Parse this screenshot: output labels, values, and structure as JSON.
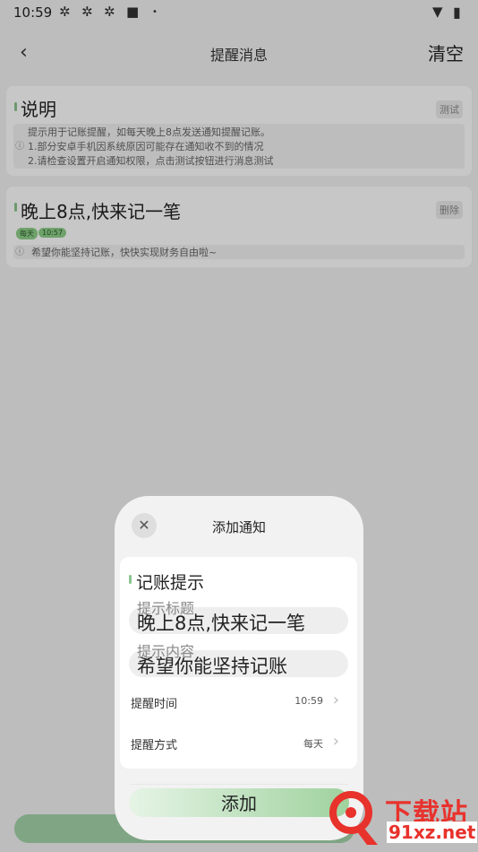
{
  "status_bar": {
    "time": "10:59",
    "icons": [
      "app-icon",
      "app-icon",
      "app-icon",
      "square-icon",
      "dot-icon",
      "wifi-icon",
      "battery-icon"
    ]
  },
  "header": {
    "back_icon": "back-arrow",
    "title": "提醒消息",
    "clear_label": "清空"
  },
  "cards": [
    {
      "title": "说明",
      "action_label": "测试",
      "note_lines": [
        "提示用于记账提醒，如每天晚上8点发送通知提醒记账。",
        "1.部分安卓手机因系统原因可能存在通知收不到的情况",
        "2.请检查设置开启通知权限，点击测试按钮进行消息测试"
      ]
    },
    {
      "title": "晚上8点,快来记一笔",
      "action_label": "删除",
      "badges": [
        "每天",
        "10:57"
      ],
      "note": "希望你能坚持记账，快快实现财务自由啦~"
    }
  ],
  "modal": {
    "title": "添加通知",
    "section_title": "记账提示",
    "title_field": {
      "placeholder": "提示标题",
      "value": "晚上8点,快来记一笔"
    },
    "content_field": {
      "placeholder": "提示内容",
      "value": "希望你能坚持记账"
    },
    "rows": [
      {
        "label": "提醒时间",
        "value": "10:59"
      },
      {
        "label": "提醒方式",
        "value": "每天"
      }
    ],
    "add_label": "添加"
  },
  "watermark": {
    "text1": "下载站",
    "text2": "91xz.net"
  },
  "colors": {
    "accent": "#8fd08a",
    "watermark": "#e8322c",
    "overlay": "rgba(0,0,0,0.22)"
  }
}
